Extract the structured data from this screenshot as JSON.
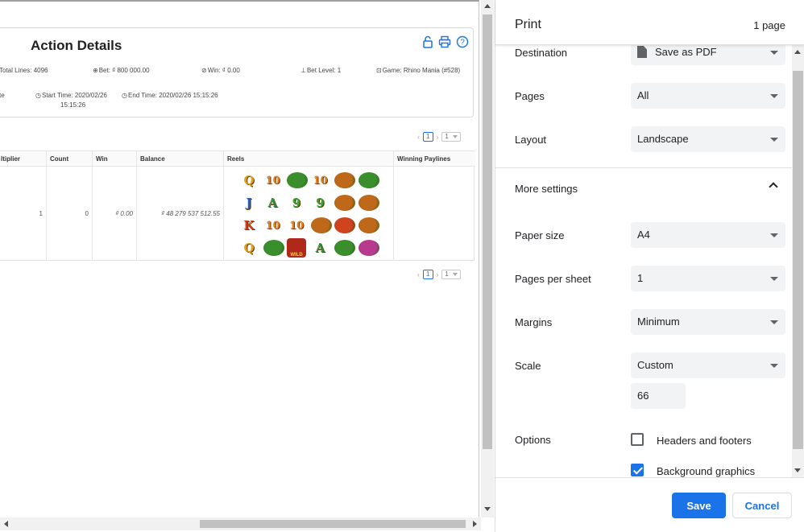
{
  "preview": {
    "title": "Action Details",
    "info": {
      "total_lines": "Total Lines: 4096",
      "bet": "Bet: ₫ 800 000.00",
      "win": "Win: ₫ 0.00",
      "bet_level": "Bet Level: 1",
      "game": "Game: Rhino Mania (#528)",
      "partial": "te",
      "start_time_line1": "Start Time: 2020/02/26",
      "start_time_line2": "15:15:26",
      "end_time": "End Time: 2020/02/26 15:15:26"
    },
    "pager": {
      "page": "1",
      "per_page": "1"
    },
    "table": {
      "headers": [
        "ltiplier",
        "Count",
        "Win",
        "Balance",
        "Reels",
        "Winning Paylines"
      ],
      "row": {
        "multiplier": "1",
        "count": "0",
        "win": "₫ 0.00",
        "balance": "₫ 48 279 537 512.55",
        "winning_paylines": ""
      }
    },
    "reels": [
      [
        "Q",
        "10",
        "rhino",
        "10",
        "lion",
        "rhino"
      ],
      [
        "J",
        "A",
        "9",
        "9",
        "lion",
        "lion"
      ],
      [
        "K",
        "10",
        "10",
        "lion",
        "tiger",
        "lion"
      ],
      [
        "Q",
        "rhino",
        "wild",
        "A",
        "rhino",
        "wolf"
      ]
    ],
    "reel_colors": {
      "rhino": "#3a8f2c",
      "lion": "#c0681a",
      "tiger": "#d0431f",
      "wolf": "#b73a8f",
      "wild": "#b0281a",
      "wild_text": "WILD"
    }
  },
  "print": {
    "title": "Print",
    "page_count": "1 page",
    "destination": {
      "label": "Destination",
      "value": "Save as PDF"
    },
    "pages": {
      "label": "Pages",
      "value": "All"
    },
    "layout": {
      "label": "Layout",
      "value": "Landscape"
    },
    "more_settings": "More settings",
    "paper_size": {
      "label": "Paper size",
      "value": "A4"
    },
    "pages_per_sheet": {
      "label": "Pages per sheet",
      "value": "1"
    },
    "margins": {
      "label": "Margins",
      "value": "Minimum"
    },
    "scale": {
      "label": "Scale",
      "value": "Custom",
      "custom_value": "66"
    },
    "options": {
      "label": "Options",
      "headers_footers": {
        "label": "Headers and footers",
        "checked": false
      },
      "background_graphics": {
        "label": "Background graphics",
        "checked": true
      }
    },
    "save_label": "Save",
    "cancel_label": "Cancel"
  },
  "colors": {
    "accent": "#1a73e8"
  }
}
